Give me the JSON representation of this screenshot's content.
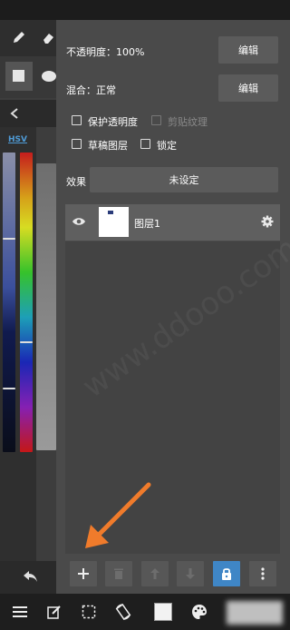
{
  "layer_panel": {
    "opacity_label": "不透明度：100%",
    "opacity_edit_button": "编辑",
    "blend_label": "混合：正常",
    "blend_edit_button": "编辑",
    "protect_alpha_label": "保护透明度",
    "clipping_label": "剪贴纹理",
    "draft_layer_label": "草稿图层",
    "lock_label": "锁定",
    "effect_label": "效果",
    "effect_value": "未设定",
    "layers": [
      {
        "name": "图层1",
        "visible": true
      }
    ]
  },
  "color_panel": {
    "mode_label": "HSV"
  },
  "watermark_text": "www.ddooo.com",
  "colors": {
    "accent": "#3f86c6",
    "arrow": "#f07b2b",
    "panel_bg": "#4a4a4a"
  },
  "icons": {
    "toolbar": [
      "add-layer-icon",
      "delete-layer-icon",
      "move-up-icon",
      "move-down-icon",
      "lock-icon",
      "more-icon"
    ],
    "bottom_bar": [
      "menu-icon",
      "edit-icon",
      "selection-icon",
      "rotate-canvas-icon",
      "color-swatch-icon",
      "palette-icon"
    ]
  }
}
